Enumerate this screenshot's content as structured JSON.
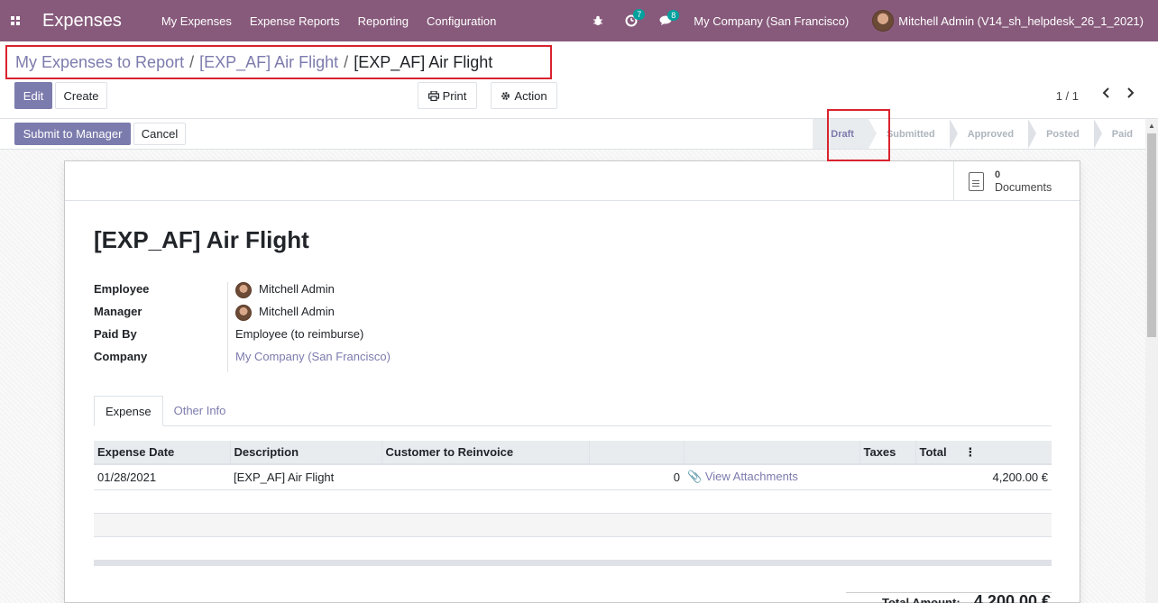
{
  "navbar": {
    "app_title": "Expenses",
    "menu": [
      "My Expenses",
      "Expense Reports",
      "Reporting",
      "Configuration"
    ],
    "activity_count": "7",
    "message_count": "8",
    "company": "My Company (San Francisco)",
    "user": "Mitchell Admin (V14_sh_helpdesk_26_1_2021)",
    "accent_color": "#875a7b"
  },
  "breadcrumb": {
    "items": [
      "My Expenses to Report",
      "[EXP_AF] Air Flight"
    ],
    "current": "[EXP_AF] Air Flight",
    "separator": "/"
  },
  "toolbar": {
    "edit": "Edit",
    "create": "Create",
    "print": "Print",
    "action": "Action",
    "pager": "1 / 1"
  },
  "statusbar": {
    "submit": "Submit to Manager",
    "cancel": "Cancel",
    "stages": [
      "Draft",
      "Submitted",
      "Approved",
      "Posted",
      "Paid"
    ],
    "active_stage": "Draft"
  },
  "sheet": {
    "documents_count": "0",
    "documents_label": "Documents",
    "title": "[EXP_AF] Air Flight",
    "fields": {
      "labels": [
        "Employee",
        "Manager",
        "Paid By",
        "Company"
      ],
      "employee": "Mitchell Admin",
      "manager": "Mitchell Admin",
      "paid_by": "Employee (to reimburse)",
      "company": "My Company (San Francisco)"
    },
    "tabs": [
      "Expense",
      "Other Info"
    ],
    "table": {
      "headers": [
        "Expense Date",
        "Description",
        "Customer to Reinvoice",
        "",
        "",
        "Taxes",
        "Total"
      ],
      "rows": [
        {
          "date": "01/28/2021",
          "description": "[EXP_AF] Air Flight",
          "customer": "",
          "qty": "0",
          "attachments": "View Attachments",
          "taxes": "",
          "total": "4,200.00 €"
        }
      ]
    },
    "total_label": "Total Amount:",
    "total_amount": "4,200.00 €"
  }
}
